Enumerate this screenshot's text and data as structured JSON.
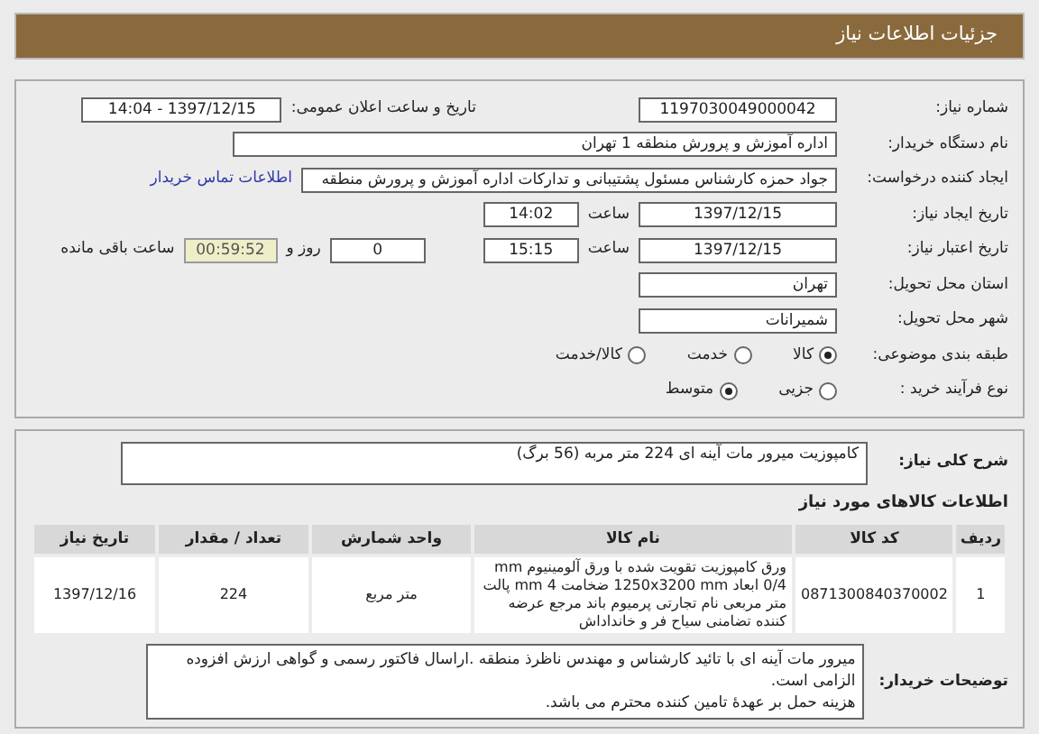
{
  "header": {
    "title": "جزئیات اطلاعات نیاز"
  },
  "need_number": {
    "label": "شماره نیاز:",
    "value": "1197030049000042"
  },
  "announce": {
    "label": "تاریخ و ساعت اعلان عمومی:",
    "value": "1397/12/15 - 14:04"
  },
  "buyer": {
    "label": "نام دستگاه خریدار:",
    "value": "اداره آموزش و پرورش منطقه 1 تهران"
  },
  "creator": {
    "label": "ایجاد کننده درخواست:",
    "value": "جواد حمزه کارشناس مسئول پشتیبانی و تدارکات اداره آموزش و پرورش منطقه",
    "link": "اطلاعات تماس خریدار"
  },
  "created": {
    "label": "تاریخ ایجاد نیاز:",
    "date": "1397/12/15",
    "time_label": "ساعت",
    "time": "14:02"
  },
  "validity": {
    "label": "تاریخ اعتبار نیاز:",
    "date": "1397/12/15",
    "time_label": "ساعت",
    "time": "15:15",
    "days": "0",
    "days_label": "روز و",
    "remaining": "00:59:52",
    "remaining_label": "ساعت باقی مانده"
  },
  "province": {
    "label": "استان محل تحویل:",
    "value": "تهران"
  },
  "city": {
    "label": "شهر محل تحویل:",
    "value": "شمیرانات"
  },
  "category": {
    "label": "طبقه بندی موضوعی:",
    "options": [
      {
        "label": "کالا",
        "selected": true
      },
      {
        "label": "خدمت",
        "selected": false
      },
      {
        "label": "کالا/خدمت",
        "selected": false
      }
    ]
  },
  "process": {
    "label": "نوع فرآیند خرید :",
    "options": [
      {
        "label": "جزیی",
        "selected": false
      },
      {
        "label": "متوسط",
        "selected": true
      }
    ]
  },
  "summary": {
    "label": "شرح کلی نیاز:",
    "value": "کامپوزیت میرور مات آینه ای 224 متر مربه (56 برگ)"
  },
  "goods_title": "اطلاعات کالاهای مورد نیاز",
  "table": {
    "columns": [
      "ردیف",
      "کد کالا",
      "نام کالا",
      "واحد شمارش",
      "تعداد / مقدار",
      "تاریخ نیاز"
    ],
    "rows": [
      [
        "1",
        "0871300840370002",
        "ورق کامپوزیت تقویت شده با ورق آلومینیوم mm 0/4 ابعاد 1250x3200 mm ضخامت 4 mm پالت متر مربعی نام تجارتی پرمیوم باند مرجع عرضه کننده تضامنی سیاح فر و خانداداش",
        "متر مربع",
        "224",
        "1397/12/16"
      ]
    ]
  },
  "notes": {
    "label": "توضیحات خریدار:",
    "lines": [
      "میرور مات آینه ای با تائید کارشناس و مهندس ناظرذ منطقه .اراسال فاکتور رسمی و گواهی ارزش افزوده الزامی است.",
      "هزینه حمل بر عهدۀ تامین کننده محترم می باشد."
    ]
  }
}
